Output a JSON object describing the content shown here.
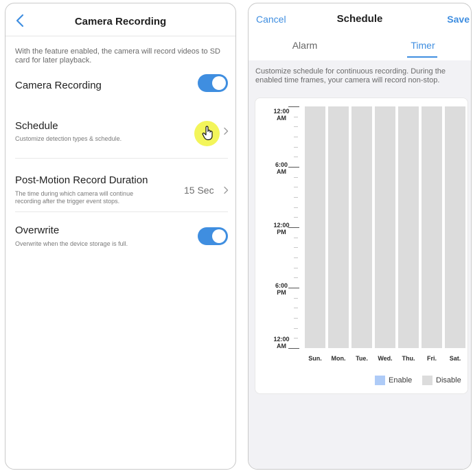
{
  "left": {
    "title": "Camera Recording",
    "intro": "With the feature enabled, the camera will record videos to SD card for later playback.",
    "camera_recording": {
      "label": "Camera Recording",
      "enabled": true
    },
    "schedule": {
      "label": "Schedule",
      "desc": "Customize detection types & schedule."
    },
    "post_motion": {
      "label": "Post-Motion Record Duration",
      "desc": "The time during which camera will continue recording after the trigger event stops.",
      "value": "15 Sec"
    },
    "overwrite": {
      "label": "Overwrite",
      "desc": "Overwrite when the device storage is full.",
      "enabled": true
    }
  },
  "right": {
    "cancel": "Cancel",
    "title": "Schedule",
    "save": "Save",
    "tabs": {
      "alarm": "Alarm",
      "timer": "Timer",
      "active": "Timer"
    },
    "intro": "Customize schedule for continuous recording. During the enabled time frames, your camera will record non-stop.",
    "times": [
      {
        "t": "12:00",
        "p": "AM"
      },
      {
        "t": "6:00",
        "p": "AM"
      },
      {
        "t": "12:00",
        "p": "PM"
      },
      {
        "t": "6:00",
        "p": "PM"
      },
      {
        "t": "12:00",
        "p": "AM"
      }
    ],
    "days": [
      "Sun.",
      "Mon.",
      "Tue.",
      "Wed.",
      "Thu.",
      "Fri.",
      "Sat."
    ],
    "legend": {
      "enable": "Enable",
      "disable": "Disable"
    }
  },
  "colors": {
    "accent": "#3f8ee0",
    "disabled_slot": "#dcdcdc",
    "enable_swatch": "#aecbf7",
    "highlight": "#f3f55a"
  },
  "icons": [
    "back-chevron-icon",
    "chevron-right-icon",
    "hand-pointer-icon"
  ]
}
